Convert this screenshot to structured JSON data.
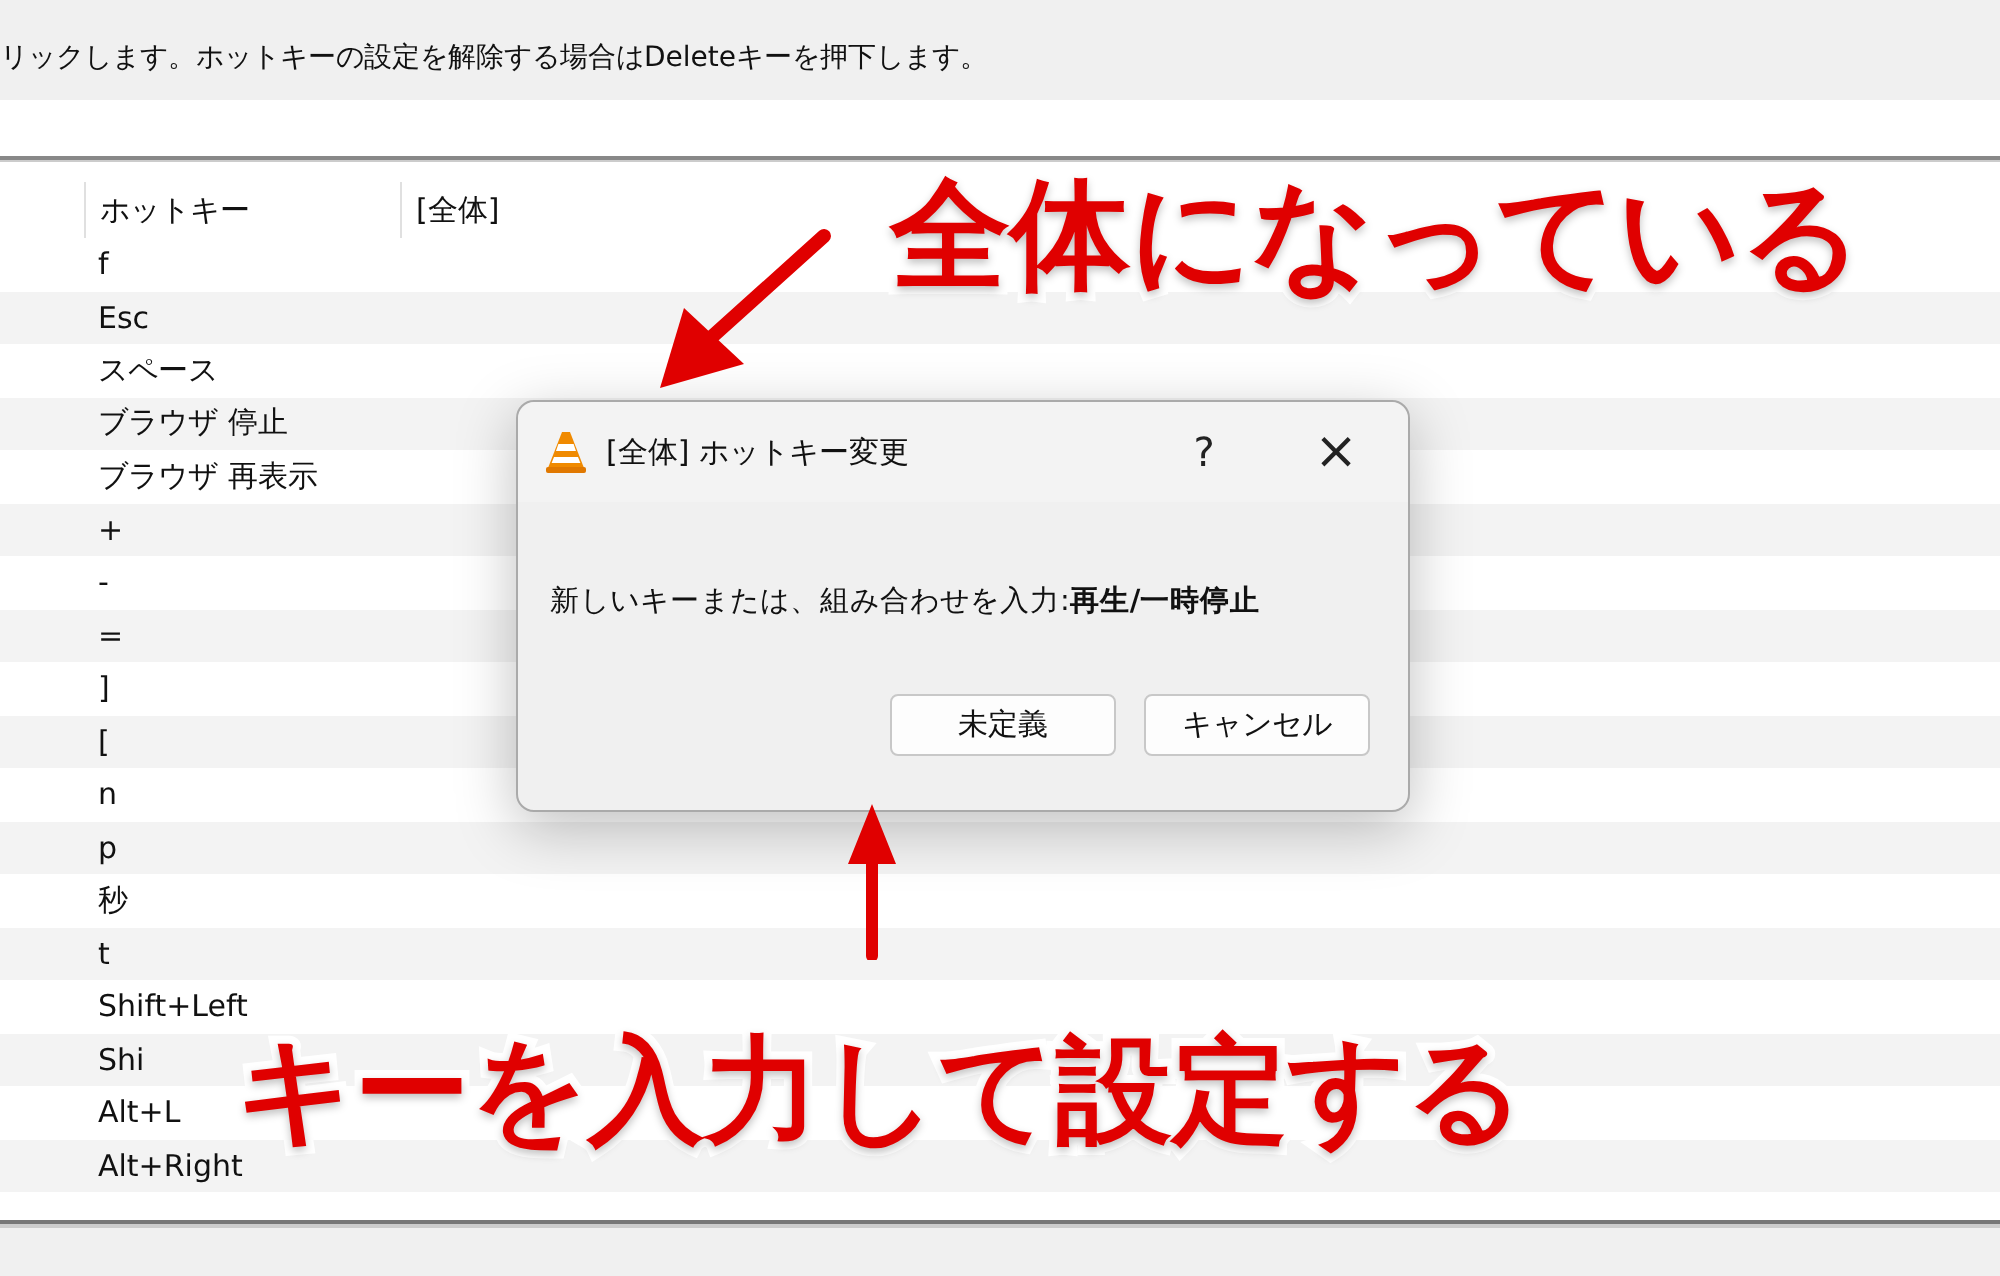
{
  "instruction": "リックします。ホットキーの設定を解除する場合はDeleteキーを押下します。",
  "table": {
    "columns": [
      "ホットキー",
      "[全体]"
    ],
    "rows": [
      {
        "hotkey": "f"
      },
      {
        "hotkey": "Esc"
      },
      {
        "hotkey": "スペース"
      },
      {
        "hotkey": "ブラウザ 停止"
      },
      {
        "hotkey": "ブラウザ 再表示"
      },
      {
        "hotkey": "+"
      },
      {
        "hotkey": "-"
      },
      {
        "hotkey": "="
      },
      {
        "hotkey": "]"
      },
      {
        "hotkey": "["
      },
      {
        "hotkey": "n"
      },
      {
        "hotkey": "p"
      },
      {
        "hotkey": "秒"
      },
      {
        "hotkey": "t"
      },
      {
        "hotkey": "Shift+Left"
      },
      {
        "hotkey": "Shi"
      },
      {
        "hotkey": "Alt+L"
      },
      {
        "hotkey": "Alt+Right"
      }
    ]
  },
  "dialog": {
    "title": "[全体] ホットキー変更",
    "help": "?",
    "close": "×",
    "message": "新しいキーまたは、組み合わせを入力:**再生/一時停止**",
    "buttons": [
      "未定義",
      "キャンセル"
    ]
  },
  "annotations": [
    {
      "text": "全体になっている",
      "kind": "top"
    },
    {
      "text": "キーを入力して設定する",
      "kind": "bottom"
    }
  ]
}
